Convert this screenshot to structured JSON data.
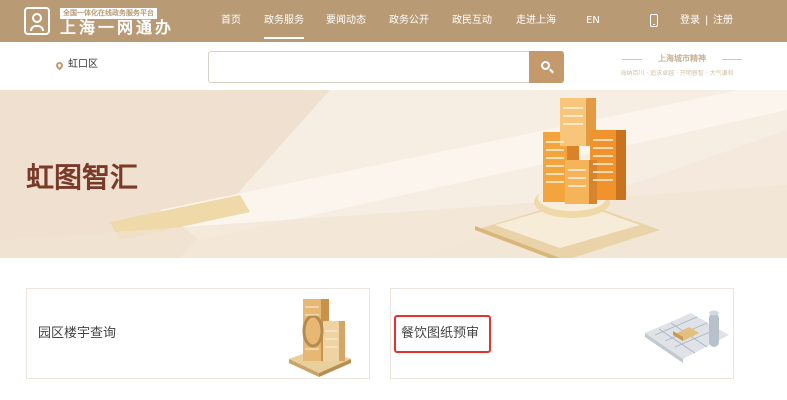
{
  "header": {
    "platform_tag": "全国一体化在线政务服务平台",
    "site_title": "上海一网通办",
    "nav_items": [
      "首页",
      "政务服务",
      "要闻动态",
      "政务公开",
      "政民互动",
      "走进上海",
      "EN"
    ],
    "active_nav": "政务服务",
    "login_label": "登录",
    "separator": "|",
    "register_label": "注册"
  },
  "location": {
    "district": "虹口区"
  },
  "search": {
    "placeholder": ""
  },
  "city_brand": {
    "title": "上海城市精神",
    "subtitle": "海纳百川 · 追求卓越 · 开明睿智 · 大气谦和"
  },
  "banner": {
    "title": "虹图智汇"
  },
  "cards": [
    {
      "title": "园区楼宇查询"
    },
    {
      "title": "餐饮图纸预审",
      "highlighted": true
    }
  ],
  "colors": {
    "nav_bg": "#b89a74",
    "accent": "#c49a6c",
    "banner_title": "#7a3a2a",
    "highlight_border": "#e5322d"
  }
}
